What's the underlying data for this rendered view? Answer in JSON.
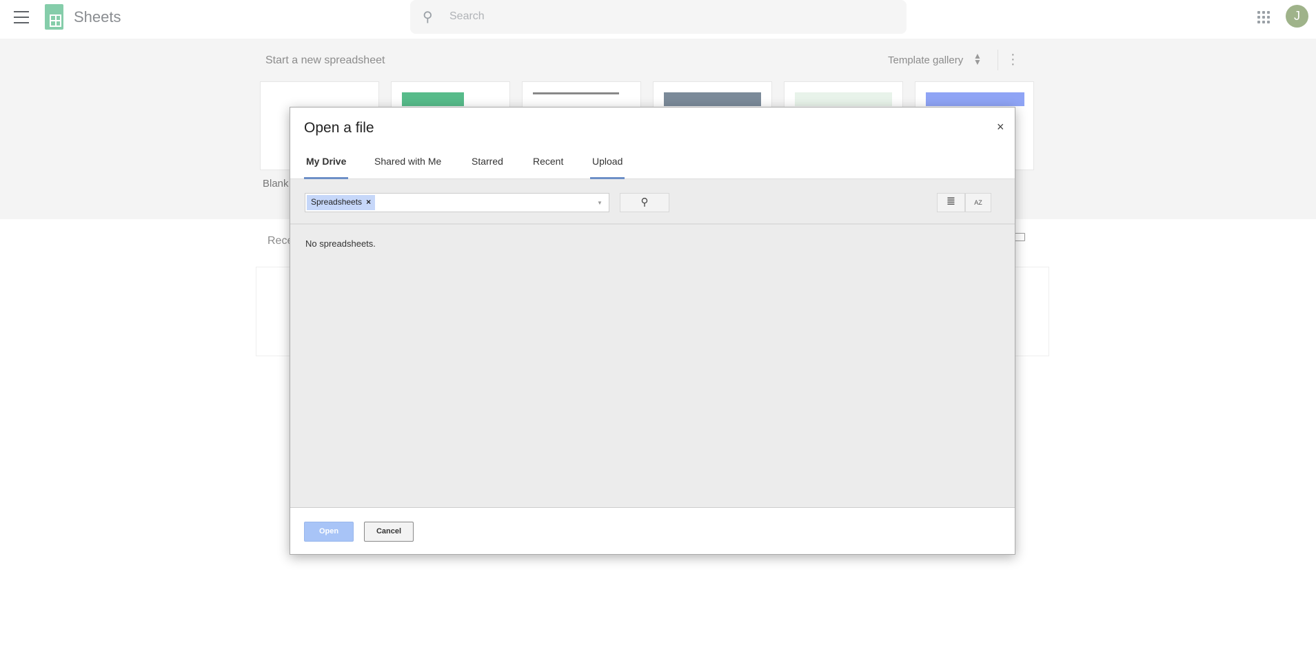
{
  "header": {
    "app_title": "Sheets",
    "search_placeholder": "Search",
    "avatar_initial": "J"
  },
  "templates": {
    "section_title": "Start a new spreadsheet",
    "gallery_label": "Template gallery",
    "blank_label": "Blank",
    "thumb_colors": [
      "#ffffff",
      "#57bb8a",
      "#ffffff",
      "#7b8a99",
      "#e8f3ea",
      "#8fa4f5"
    ]
  },
  "recent": {
    "title_partial": "Rece"
  },
  "dialog": {
    "title": "Open a file",
    "close_symbol": "×",
    "tabs": [
      {
        "label": "My Drive",
        "active": true
      },
      {
        "label": "Shared with Me"
      },
      {
        "label": "Starred"
      },
      {
        "label": "Recent"
      },
      {
        "label": "Upload"
      }
    ],
    "filter_chip": "Spreadsheets",
    "chip_remove": "×",
    "search_icon": "🔍",
    "sort_label": "AZ",
    "empty_message": "No spreadsheets.",
    "open_label": "Open",
    "cancel_label": "Cancel"
  }
}
